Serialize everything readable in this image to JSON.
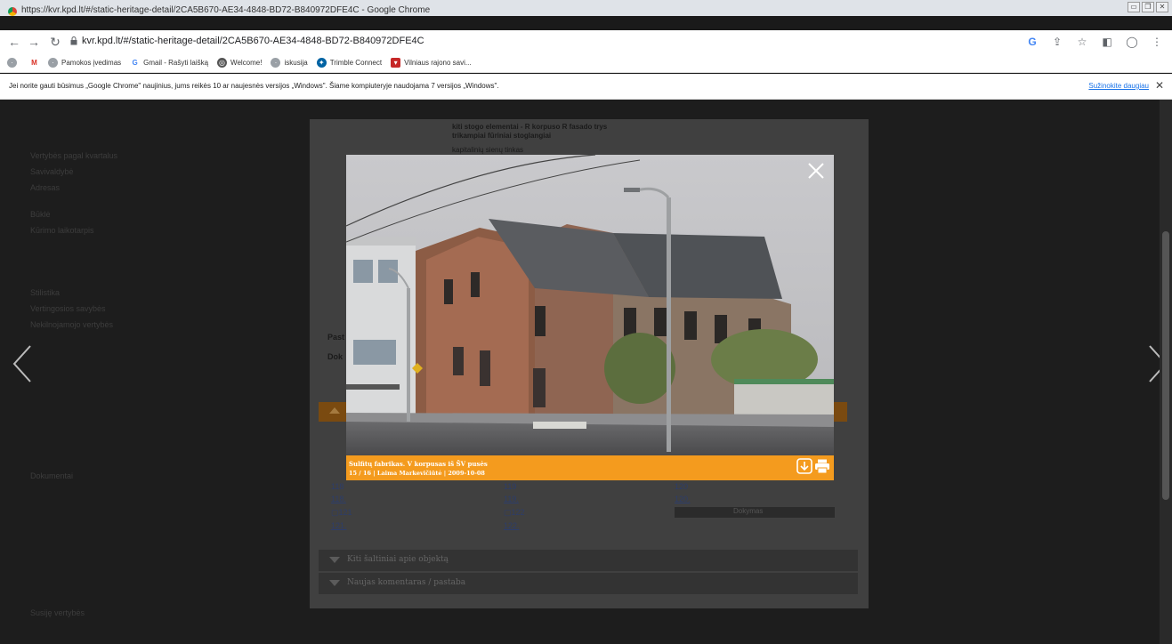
{
  "browser": {
    "window_title": "https://kvr.kpd.lt/#/static-heritage-detail/2CA5B670-AE34-4848-BD72-B840972DFE4C - Google Chrome",
    "url": "kvr.kpd.lt/#/static-heritage-detail/2CA5B670-AE34-4848-BD72-B840972DFE4C",
    "bookmarks": [
      {
        "label": "",
        "icon": "globe-icon"
      },
      {
        "label": "Pamokos įvedimas",
        "icon": "globe-icon"
      },
      {
        "label": "Gmail - Rašyti laišką",
        "icon": "google-icon"
      },
      {
        "label": "Welcome!",
        "icon": "globe-icon"
      },
      {
        "label": "iskusija",
        "icon": "globe-icon"
      },
      {
        "label": "Trimble Connect",
        "icon": "trimble-icon"
      },
      {
        "label": "Vilniaus rajono savi...",
        "icon": "shield-icon"
      }
    ],
    "infobar": {
      "message": "Jei norite gauti būsimus „Google Chrome\" naujinius, jums reikės 10 ar naujesnės versijos „Windows\". Šiame kompiuteryje naudojama 7 versijos „Windows\".",
      "link": "Sužinokite daugiau",
      "close": "✕"
    }
  },
  "background_page": {
    "sidebar": [
      "Vertybės pagal kvartalus",
      "Savivaldybė",
      "Adresas",
      "Būklė",
      "Kūrimo laikotarpis",
      "Stilistika",
      "Vertingosios savybės",
      "Nekilnojamojo vertybės",
      "Dokumentai",
      "Susiję vertybės"
    ]
  },
  "modal": {
    "side_labels": {
      "pasta": "Past",
      "dok": "Dok"
    },
    "thumbs": [
      {
        "img": "118",
        "link": "118."
      },
      {
        "img": "119",
        "link": "119."
      },
      {
        "img": "120",
        "link": "120."
      },
      {
        "img": "121",
        "link": "121."
      },
      {
        "img": "122",
        "link": "122."
      }
    ],
    "dokbox_label": "Dokymas",
    "accordion": [
      {
        "label": "Kiti šaltiniai apie objektą"
      },
      {
        "label": "Naujas komentaras / pastaba"
      }
    ],
    "text_fragments": {
      "line1": "kiti stogo elementai - R korpuso R fasado trys",
      "line2": "trikampiai fūriniai stoglangiai",
      "line3": "kapitalinių sienų tinkas"
    }
  },
  "lightbox": {
    "caption_title": "Sulfitų fabrikas. V korpusas iš ŠV pusės",
    "caption_meta": "15 / 16 | Laima Markevičiūtė | 2009-10-08",
    "close_icon": "close-icon",
    "download_icon": "download-icon",
    "print_icon": "print-icon",
    "accent": "#f49b1e"
  }
}
